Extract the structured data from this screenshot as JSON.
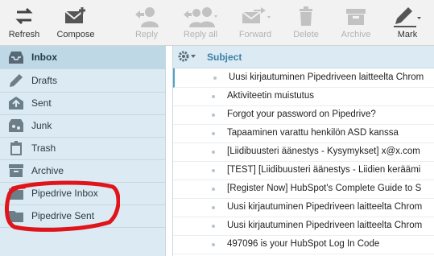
{
  "toolbar": {
    "refresh": "Refresh",
    "compose": "Compose",
    "reply": "Reply",
    "reply_all": "Reply all",
    "forward": "Forward",
    "delete": "Delete",
    "archive": "Archive",
    "mark": "Mark"
  },
  "sidebar": {
    "items": [
      {
        "label": "Inbox",
        "icon": "inbox-icon"
      },
      {
        "label": "Drafts",
        "icon": "pencil-icon"
      },
      {
        "label": "Sent",
        "icon": "sent-icon"
      },
      {
        "label": "Junk",
        "icon": "junk-icon"
      },
      {
        "label": "Trash",
        "icon": "trash-icon"
      },
      {
        "label": "Archive",
        "icon": "archive-icon"
      },
      {
        "label": "Pipedrive Inbox",
        "icon": "folder-icon"
      },
      {
        "label": "Pipedrive Sent",
        "icon": "folder-icon"
      }
    ]
  },
  "list": {
    "header": "Subject",
    "rows": [
      "Uusi kirjautuminen Pipedriveen laitteelta Chrom",
      "Aktiviteetin muistutus",
      "Forgot your password on Pipedrive?",
      "Tapaaminen varattu henkilön ASD kanssa",
      "[Liidibuusteri äänestys - Kysymykset] x@x.com",
      "[TEST] [Liidibuusteri äänestys - Liidien keräämi",
      "[Register Now] HubSpot's Complete Guide to S",
      "Uusi kirjautuminen Pipedriveen laitteelta Chrom",
      "Uusi kirjautuminen Pipedriveen laitteelta Chrom",
      "497096 is your HubSpot Log In Code"
    ]
  },
  "colors": {
    "sidebar_bg": "#dcebf3",
    "selected_bg": "#bed8e6",
    "accent": "#3a7fa7",
    "annotation": "#e0141b"
  }
}
